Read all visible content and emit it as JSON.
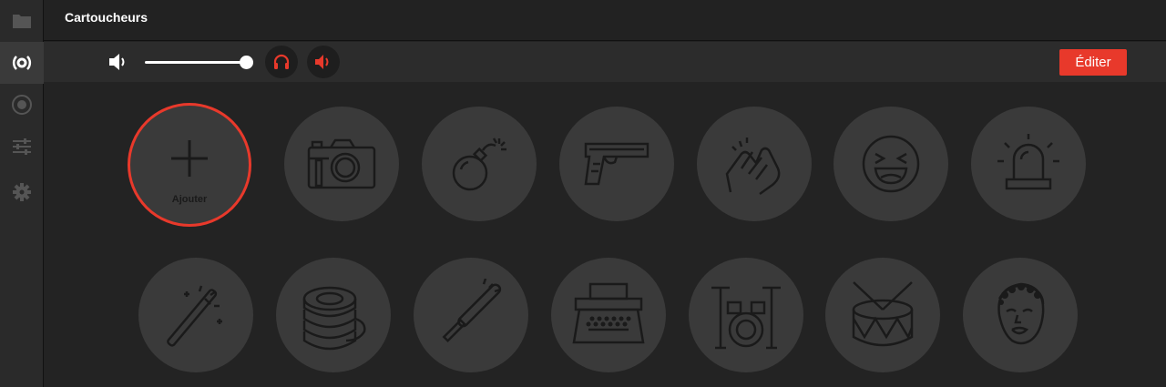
{
  "app": {
    "title": "Cartoucheurs",
    "accent_color": "#e8392b"
  },
  "sidebar": {
    "items": [
      {
        "icon": "folder-icon",
        "active": false
      },
      {
        "icon": "broadcast-icon",
        "active": true
      },
      {
        "icon": "record-icon",
        "active": false
      },
      {
        "icon": "sliders-icon",
        "active": false
      },
      {
        "icon": "gear-icon",
        "active": false
      }
    ]
  },
  "toolbar": {
    "volume_level": 1.0,
    "headphones_icon": "headphones-icon",
    "speaker_icon": "speaker-icon",
    "edit_label": "Éditer"
  },
  "pads": {
    "add_label": "Ajouter",
    "items": [
      {
        "icon": "camera-icon"
      },
      {
        "icon": "bomb-icon"
      },
      {
        "icon": "pistol-icon"
      },
      {
        "icon": "clapping-hands-icon"
      },
      {
        "icon": "laughing-face-icon"
      },
      {
        "icon": "siren-icon"
      },
      {
        "icon": "magic-wand-icon"
      },
      {
        "icon": "coins-icon"
      },
      {
        "icon": "lightsaber-icon"
      },
      {
        "icon": "typewriter-icon"
      },
      {
        "icon": "drum-kit-icon"
      },
      {
        "icon": "drum-icon"
      },
      {
        "icon": "meme-face-icon"
      }
    ]
  }
}
